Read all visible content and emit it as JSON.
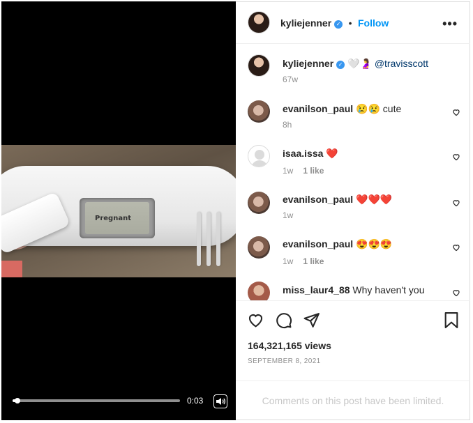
{
  "video": {
    "display_text": "Pregnant",
    "time": "0:03",
    "progress": 0.02,
    "icons": {
      "volume": "volume-icon"
    }
  },
  "header": {
    "username": "kyliejenner",
    "separator": "•",
    "follow_label": "Follow",
    "icons": {
      "more": "more-options-icon",
      "verified": "verified-badge-icon"
    }
  },
  "caption": {
    "username": "kyliejenner",
    "emojis": "🤍🤰",
    "mention": "@travisscott",
    "time": "67w"
  },
  "comments": [
    {
      "username": "evanilson_paul",
      "text": "😢😢 cute",
      "time": "8h",
      "likes": ""
    },
    {
      "username": "isaa.issa",
      "text": "❤️",
      "time": "1w",
      "likes": "1 like"
    },
    {
      "username": "evanilson_paul",
      "text": "❤️❤️❤️",
      "time": "1w",
      "likes": ""
    },
    {
      "username": "evanilson_paul",
      "text": "😍😍😍",
      "time": "1w",
      "likes": "1 like"
    },
    {
      "username": "miss_laur4_88",
      "text": "Why haven't you",
      "time": "",
      "likes": ""
    }
  ],
  "actions": {
    "icons": [
      "like-icon",
      "comment-icon",
      "share-icon",
      "save-icon"
    ]
  },
  "stats": {
    "views": "164,321,165 views",
    "date": "SEPTEMBER 8, 2021"
  },
  "footer": {
    "limited_text": "Comments on this post have been limited."
  },
  "colors": {
    "accent": "#0095f6",
    "verified": "#3897f0",
    "muted": "#8e8e8e"
  }
}
